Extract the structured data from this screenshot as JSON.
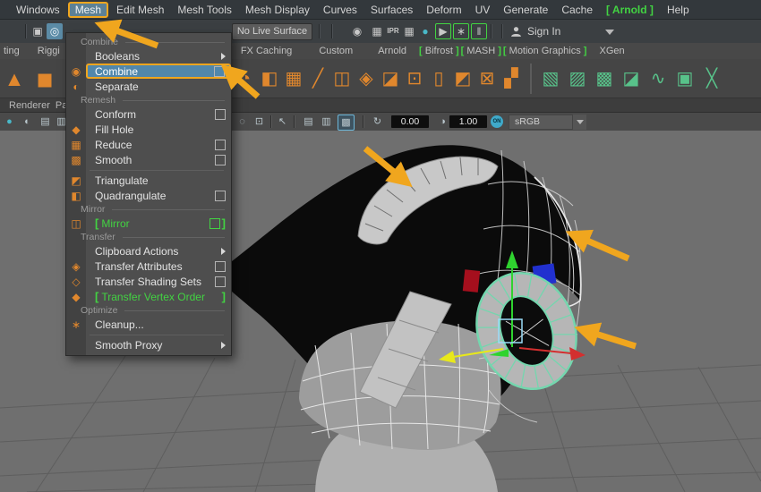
{
  "colors": {
    "accent_orange": "#f0a61e",
    "selection_blue": "#5187ab",
    "maya_green": "#42d342",
    "viewport_grey": "#6f6f6f"
  },
  "menubar": {
    "items": [
      {
        "label": "Windows"
      },
      {
        "label": "Mesh",
        "open": true
      },
      {
        "label": "Edit Mesh"
      },
      {
        "label": "Mesh Tools"
      },
      {
        "label": "Mesh Display"
      },
      {
        "label": "Curves"
      },
      {
        "label": "Surfaces"
      },
      {
        "label": "Deform"
      },
      {
        "label": "UV"
      },
      {
        "label": "Generate"
      },
      {
        "label": "Cache"
      },
      {
        "label": "Arnold",
        "bracketed": true
      },
      {
        "label": "Help"
      }
    ]
  },
  "statusline": {
    "left_icons": [
      {
        "name": "selection-mask-icon",
        "glyph": "▣"
      },
      {
        "name": "snap-highlight-icon",
        "glyph": "◎",
        "active": true
      }
    ],
    "live_surface_label": "No Live Surface",
    "right_icons": [
      {
        "name": "eye-icon",
        "glyph": "◉"
      },
      {
        "name": "panels-icon",
        "glyph": "▦"
      },
      {
        "name": "ipr-render-icon",
        "glyph": "IPR",
        "txt": true
      },
      {
        "name": "render-settings-icon",
        "glyph": "▦"
      },
      {
        "name": "render-view-icon",
        "glyph": "●",
        "teal": true
      },
      {
        "name": "render-sequence-icon",
        "glyph": "▶",
        "bracketed": true
      },
      {
        "name": "arnold-utility-icon",
        "glyph": "∗",
        "bracketed": true
      },
      {
        "name": "pause-viewport-icon",
        "glyph": "‖",
        "bracketed": true
      }
    ],
    "sign_in_label": "Sign In"
  },
  "shelf": {
    "tabs": [
      {
        "label": "ting"
      },
      {
        "label": "Riggi"
      },
      {
        "label": "FX Caching"
      },
      {
        "label": "Custom"
      },
      {
        "label": "Arnold"
      },
      {
        "label": "Bifrost",
        "bracketed": true
      },
      {
        "label": "MASH",
        "bracketed": true
      },
      {
        "label": "Motion Graphics",
        "bracketed": true
      },
      {
        "label": "XGen"
      }
    ],
    "bracket": "[",
    "icons_left": [
      {
        "name": "poly-pyramid-icon",
        "glyph": "▲"
      },
      {
        "name": "poly-cylinder-icon",
        "glyph": "◼"
      }
    ],
    "icons_mid": [
      {
        "name": "poly-sphere-icon",
        "glyph": "◔"
      },
      {
        "name": "poly-cube-icon",
        "glyph": "◧"
      },
      {
        "name": "poly-grid-icon",
        "glyph": "▦"
      },
      {
        "name": "curve-tool-icon",
        "glyph": "╱"
      },
      {
        "name": "poly-cylinder2-icon",
        "glyph": "◫"
      },
      {
        "name": "plane-diamond-icon",
        "glyph": "◈"
      },
      {
        "name": "cube-shaded-icon",
        "glyph": "◪"
      },
      {
        "name": "select-cube-icon",
        "glyph": "⊡"
      },
      {
        "name": "vertex-frame-icon",
        "glyph": "▯"
      },
      {
        "name": "face-split-icon",
        "glyph": "◩"
      },
      {
        "name": "lattice-icon",
        "glyph": "⊠"
      },
      {
        "name": "quad-draw-icon",
        "glyph": "▞"
      }
    ],
    "icons_green": [
      {
        "name": "nurbs-plane-icon",
        "glyph": "▧"
      },
      {
        "name": "nurbs-surface-icon",
        "glyph": "▨"
      },
      {
        "name": "nurbs-patch-icon",
        "glyph": "▩"
      },
      {
        "name": "nurbs-cube-icon",
        "glyph": "◪"
      },
      {
        "name": "nurbs-curve-icon",
        "glyph": "∿"
      },
      {
        "name": "uv-checker-icon",
        "glyph": "▣"
      },
      {
        "name": "cross-arrows-icon",
        "glyph": "╳"
      }
    ]
  },
  "panel_menu": {
    "items": [
      "Renderer",
      "Panels"
    ]
  },
  "viewport_bar": {
    "icons": [
      {
        "name": "lighting-icon",
        "glyph": "●",
        "teal": true
      },
      {
        "name": "shadows-icon",
        "glyph": "◐"
      },
      {
        "name": "ao-icon",
        "glyph": "▤"
      },
      {
        "name": "motion-blur-icon",
        "glyph": "▥"
      },
      {
        "name": "isolate-select-icon",
        "glyph": "◌"
      },
      {
        "name": "lock-camera-icon",
        "glyph": "⊡"
      },
      {
        "name": "select-arrow-icon",
        "glyph": "↖"
      },
      {
        "name": "wireframe-icon",
        "glyph": "▤"
      },
      {
        "name": "shaded-icon",
        "glyph": "▥"
      },
      {
        "name": "textured-icon",
        "glyph": "▩",
        "active": true
      },
      {
        "name": "refresh-icon",
        "glyph": "↻"
      },
      {
        "name": "gamma-icon",
        "glyph": "◑"
      }
    ],
    "exposure_value": "0.00",
    "gamma_value": "1.00",
    "colorspace": "sRGB gamma"
  },
  "mesh_menu": {
    "items": [
      {
        "t": "h",
        "label": "Combine"
      },
      {
        "t": "i",
        "label": "Booleans",
        "sub": true
      },
      {
        "t": "i",
        "label": "Combine",
        "icon": "combine-icon",
        "glyph": "◉",
        "check": true,
        "sel": true
      },
      {
        "t": "i",
        "label": "Separate",
        "icon": "separate-icon",
        "glyph": "◐"
      },
      {
        "t": "h",
        "label": "Remesh"
      },
      {
        "t": "i",
        "label": "Conform",
        "check": true
      },
      {
        "t": "i",
        "label": "Fill Hole",
        "icon": "fill-hole-icon",
        "glyph": "◆"
      },
      {
        "t": "i",
        "label": "Reduce",
        "icon": "reduce-icon",
        "glyph": "▦",
        "check": true
      },
      {
        "t": "i",
        "label": "Smooth",
        "icon": "smooth-icon",
        "glyph": "▩",
        "check": true
      },
      {
        "t": "s"
      },
      {
        "t": "i",
        "label": "Triangulate",
        "icon": "triangulate-icon",
        "glyph": "◩"
      },
      {
        "t": "i",
        "label": "Quadrangulate",
        "icon": "quadrangulate-icon",
        "glyph": "◧",
        "check": true
      },
      {
        "t": "h",
        "label": "Mirror"
      },
      {
        "t": "i",
        "label": "Mirror",
        "icon": "mirror-icon",
        "glyph": "◫",
        "check": true,
        "green": true
      },
      {
        "t": "h",
        "label": "Transfer"
      },
      {
        "t": "i",
        "label": "Clipboard Actions",
        "sub": true
      },
      {
        "t": "i",
        "label": "Transfer Attributes",
        "icon": "transfer-attributes-icon",
        "glyph": "◈",
        "check": true
      },
      {
        "t": "i",
        "label": "Transfer Shading Sets",
        "icon": "transfer-shading-sets-icon",
        "glyph": "◇",
        "check": true
      },
      {
        "t": "i",
        "label": "Transfer Vertex Order",
        "icon": "transfer-vertex-order-icon",
        "glyph": "◆",
        "green": true
      },
      {
        "t": "h",
        "label": "Optimize"
      },
      {
        "t": "i",
        "label": "Cleanup...",
        "icon": "cleanup-icon",
        "glyph": "∗"
      },
      {
        "t": "s"
      },
      {
        "t": "i",
        "label": "Smooth Proxy",
        "sub": true
      }
    ]
  },
  "annotations": {
    "arrow_color": "#f0a61e",
    "arrows": [
      "mesh-menu-arrow",
      "combine-option-arrow",
      "helmet-top-arrow",
      "helmet-right-arrow",
      "ear-ring-arrow"
    ]
  }
}
